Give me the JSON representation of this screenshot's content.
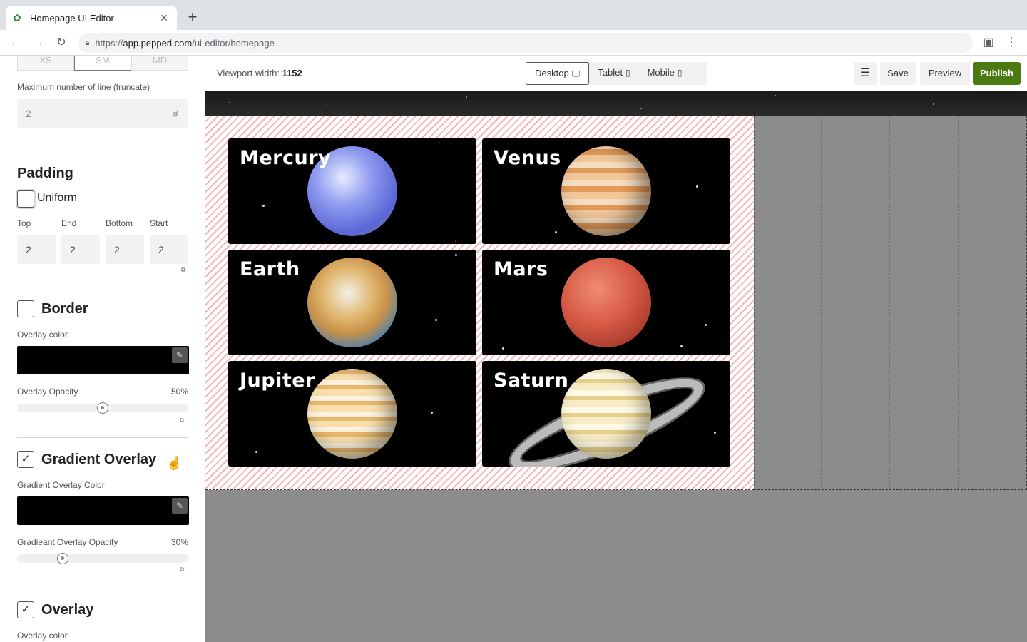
{
  "browser": {
    "tab_title": "Homepage UI Editor",
    "url_proto": "https://",
    "url_host": "app.pepperi.com",
    "url_path": "/ui-editor/homepage"
  },
  "panel": {
    "size_options": [
      "XS",
      "SM",
      "MD"
    ],
    "selected_size": "SM",
    "max_lines_label": "Maximum number of line (truncate)",
    "max_lines_value": "2",
    "max_lines_suffix": "#",
    "padding": {
      "title": "Padding",
      "uniform_label": "Uniform",
      "uniform_checked": false,
      "fields": [
        {
          "label": "Top",
          "value": "2"
        },
        {
          "label": "End",
          "value": "2"
        },
        {
          "label": "Bottom",
          "value": "2"
        },
        {
          "label": "Start",
          "value": "2"
        }
      ]
    },
    "border": {
      "title": "Border",
      "checked": false,
      "overlay_color_label": "Overlay color",
      "overlay_color": "#000000",
      "opacity_label": "Overlay Opacity",
      "opacity_value": "50%",
      "opacity_fraction": 0.5
    },
    "gradient_overlay": {
      "title": "Gradient Overlay",
      "checked": true,
      "color_label": "Gradient Overlay Color",
      "color": "#000000",
      "opacity_label": "Gradieant Overlay Opacity",
      "opacity_value": "30%",
      "opacity_fraction": 0.25
    },
    "overlay": {
      "title": "Overlay",
      "checked": true,
      "color_label": "Overlay color"
    }
  },
  "header": {
    "viewport_label": "Viewport width:",
    "viewport_value": "1152",
    "devices": [
      {
        "label": "Desktop",
        "icon": "desktop-icon",
        "active": true
      },
      {
        "label": "Tablet",
        "icon": "tablet-icon",
        "active": false
      },
      {
        "label": "Mobile",
        "icon": "mobile-icon",
        "active": false
      }
    ],
    "menu_icon": "hamburger-icon",
    "save_label": "Save",
    "preview_label": "Preview",
    "publish_label": "Publish",
    "publish_color": "#4a7a11"
  },
  "cards": [
    {
      "name": "Mercury"
    },
    {
      "name": "Venus"
    },
    {
      "name": "Earth"
    },
    {
      "name": "Mars"
    },
    {
      "name": "Jupiter"
    },
    {
      "name": "Saturn"
    }
  ]
}
